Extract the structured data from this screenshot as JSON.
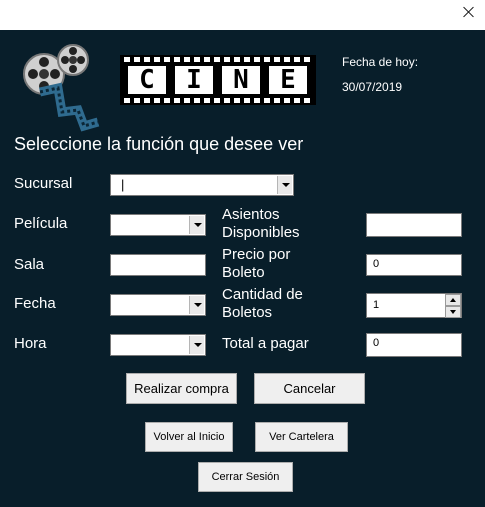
{
  "window": {
    "close_label": "×"
  },
  "logo": {
    "letters": [
      "C",
      "I",
      "N",
      "E"
    ]
  },
  "date": {
    "label": "Fecha de hoy:",
    "value": "30/07/2019"
  },
  "heading": "Seleccione la función que desee ver",
  "form": {
    "sucursal_label": "Sucursal",
    "sucursal_value": "|",
    "pelicula_label": "Película",
    "sala_label": "Sala",
    "fecha_label": "Fecha",
    "hora_label": "Hora",
    "asientos_label_1": "Asientos",
    "asientos_label_2": "Disponibles",
    "precio_label_1": "Precio por",
    "precio_label_2": "Boleto",
    "precio_value": "0",
    "cantidad_label_1": "Cantidad de",
    "cantidad_label_2": "Boletos",
    "cantidad_value": "1",
    "total_label": "Total a pagar",
    "total_value": "0"
  },
  "buttons": {
    "comprar": "Realizar compra",
    "cancelar": "Cancelar",
    "volver": "Volver al Inicio",
    "cartelera": "Ver Cartelera",
    "cerrar": "Cerrar Sesión"
  }
}
